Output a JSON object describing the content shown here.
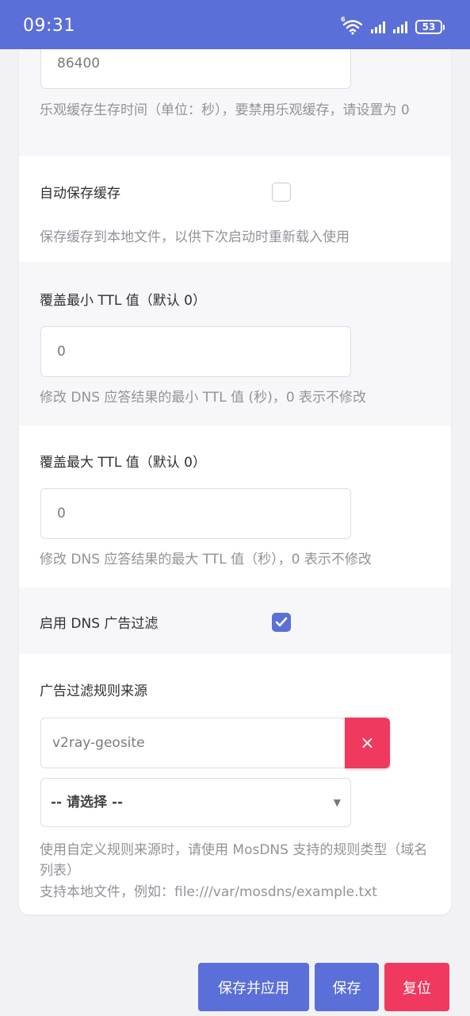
{
  "status_bar": {
    "time": "09:31",
    "network": "6",
    "battery": "53"
  },
  "ttl_field": {
    "value": "86400",
    "help": "乐观缓存生存时间（单位：秒），要禁用乐观缓存，请设置为 0"
  },
  "auto_save": {
    "label": "自动保存缓存",
    "checked": false,
    "help": "保存缓存到本地文件，以供下次启动时重新载入使用"
  },
  "min_ttl": {
    "label": "覆盖最小 TTL 值（默认 0）",
    "value": "0",
    "help": "修改 DNS 应答结果的最小 TTL 值 (秒)，0 表示不修改"
  },
  "max_ttl": {
    "label": "覆盖最大 TTL 值（默认 0）",
    "value": "0",
    "help": "修改 DNS 应答结果的最大 TTL 值（秒），0 表示不修改"
  },
  "ad_filter": {
    "label": "启用 DNS 广告过滤",
    "checked": true
  },
  "ad_sources": {
    "label": "广告过滤规则来源",
    "entry_value": "v2ray-geosite",
    "remove_glyph": "×",
    "select_value": "-- 请选择 --",
    "help_line1": "使用自定义规则来源时，请使用 MosDNS 支持的规则类型（域名列表）",
    "help_line2": "支持本地文件，例如：file:///var/mosdns/example.txt"
  },
  "actions": {
    "save_apply": "保存并应用",
    "save": "保存",
    "reset": "复位"
  },
  "colors": {
    "accent": "#5b6fd8",
    "danger": "#f0395f"
  }
}
